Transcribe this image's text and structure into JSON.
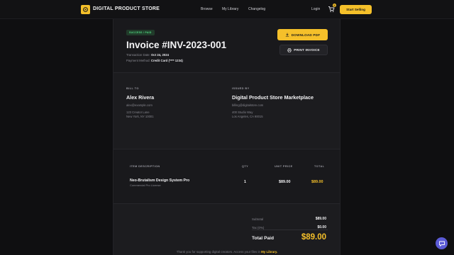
{
  "header": {
    "brand": "DIGITAL PRODUCT STORE",
    "nav": [
      "Browse",
      "My Library",
      "Changelog"
    ],
    "login": "Login",
    "cart_count": "0",
    "start_selling": "Start Selling"
  },
  "invoice": {
    "status": "SUCCESS / PAID",
    "title": "Invoice #INV-2023-001",
    "date_label": "Transaction Date:",
    "date": "Oct 24, 2024",
    "payment_label": "Payment Method:",
    "payment": "Credit Card (**** 1234)",
    "download_label": "DOWNLOAD PDF",
    "print_label": "PRINT INVOICE"
  },
  "bill_to": {
    "label": "BILL TO",
    "name": "Alex Rivera",
    "email": "alex@example.com",
    "address1": "123 Creator Lane",
    "address2": "New York, NY 10001"
  },
  "issued_by": {
    "label": "ISSUED BY",
    "name": "Digital Product Store Marketplace",
    "email": "billing@digitalstore.com",
    "address1": "400 Studio Way",
    "address2": "Los Angeles, CA 90015"
  },
  "items": {
    "headers": [
      "ITEM DESCRIPTION",
      "QTY",
      "UNIT PRICE",
      "TOTAL"
    ],
    "rows": [
      {
        "name": "Neo-Brutalism Design System Pro",
        "license": "Commercial Pro License",
        "qty": "1",
        "unit_price": "$89.00",
        "total": "$89.00"
      }
    ]
  },
  "totals": {
    "subtotal_label": "Subtotal",
    "subtotal": "$89.00",
    "tax_label": "Tax (0%)",
    "tax": "$0.00",
    "paid_label": "Total Paid",
    "paid": "$89.00"
  },
  "footer": {
    "note": "Thank you for supporting digital creators. Access your files in",
    "link": "My Library."
  },
  "colors": {
    "accent": "#f5c02a",
    "success": "#4fd680",
    "chat": "#5b5bd6"
  }
}
